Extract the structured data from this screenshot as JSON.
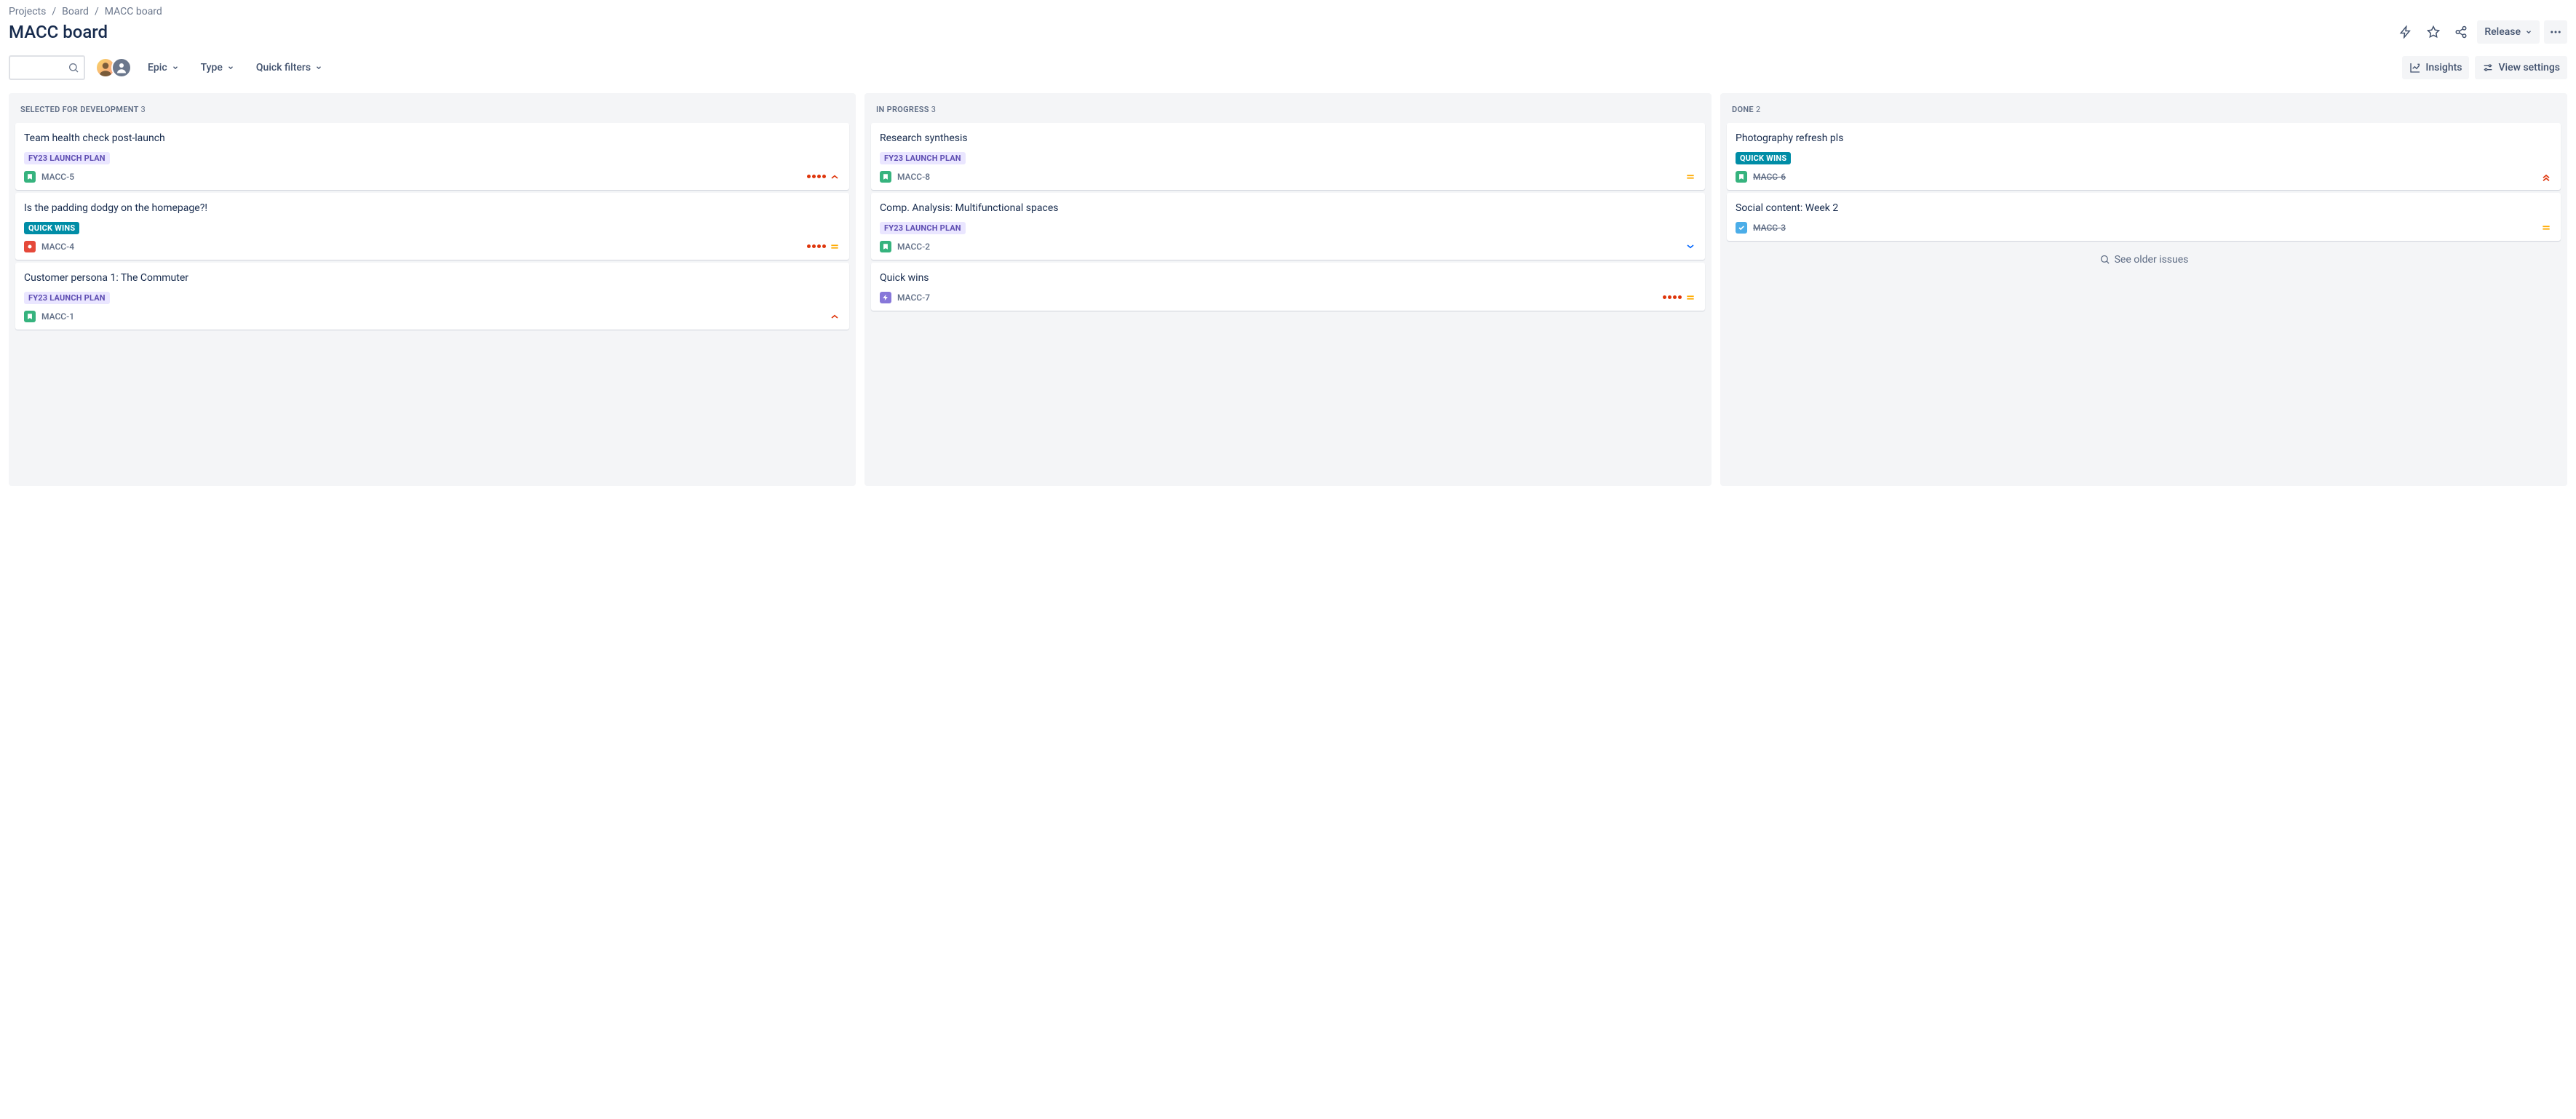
{
  "breadcrumb": [
    {
      "label": "Projects"
    },
    {
      "label": "Board"
    },
    {
      "label": "MACC board"
    }
  ],
  "page_title": "MACC board",
  "header": {
    "release_label": "Release"
  },
  "toolbar": {
    "epic_label": "Epic",
    "type_label": "Type",
    "quick_filters_label": "Quick filters",
    "insights_label": "Insights",
    "view_settings_label": "View settings",
    "search_placeholder": ""
  },
  "older_issues_label": "See older issues",
  "columns": [
    {
      "name": "SELECTED FOR DEVELOPMENT",
      "count": 3,
      "cards": [
        {
          "title": "Team health check post-launch",
          "tag": "FY23 LAUNCH PLAN",
          "tag_style": "launch",
          "type": "story",
          "key": "MACC-5",
          "dots": 4,
          "priority": "high",
          "done": false
        },
        {
          "title": "Is the padding dodgy on the homepage?!",
          "tag": "QUICK WINS",
          "tag_style": "quick",
          "type": "bug",
          "key": "MACC-4",
          "dots": 4,
          "priority": "medium",
          "done": false
        },
        {
          "title": "Customer persona 1: The Commuter",
          "tag": "FY23 LAUNCH PLAN",
          "tag_style": "launch",
          "type": "story",
          "key": "MACC-1",
          "dots": 0,
          "priority": "high",
          "done": false
        }
      ]
    },
    {
      "name": "IN PROGRESS",
      "count": 3,
      "cards": [
        {
          "title": "Research synthesis",
          "tag": "FY23 LAUNCH PLAN",
          "tag_style": "launch",
          "type": "story",
          "key": "MACC-8",
          "dots": 0,
          "priority": "medium",
          "done": false
        },
        {
          "title": "Comp. Analysis: Multifunctional spaces",
          "tag": "FY23 LAUNCH PLAN",
          "tag_style": "launch",
          "type": "story",
          "key": "MACC-2",
          "dots": 0,
          "priority": "low",
          "done": false
        },
        {
          "title": "Quick wins",
          "tag": null,
          "tag_style": null,
          "type": "epic",
          "key": "MACC-7",
          "dots": 4,
          "priority": "medium",
          "done": false
        }
      ]
    },
    {
      "name": "DONE",
      "count": 2,
      "see_older": true,
      "cards": [
        {
          "title": "Photography refresh pls",
          "tag": "QUICK WINS",
          "tag_style": "quick",
          "type": "story",
          "key": "MACC-6",
          "dots": 0,
          "priority": "highest",
          "done": true
        },
        {
          "title": "Social content: Week 2",
          "tag": null,
          "tag_style": null,
          "type": "task",
          "key": "MACC-3",
          "dots": 0,
          "priority": "medium",
          "done": true
        }
      ]
    }
  ]
}
